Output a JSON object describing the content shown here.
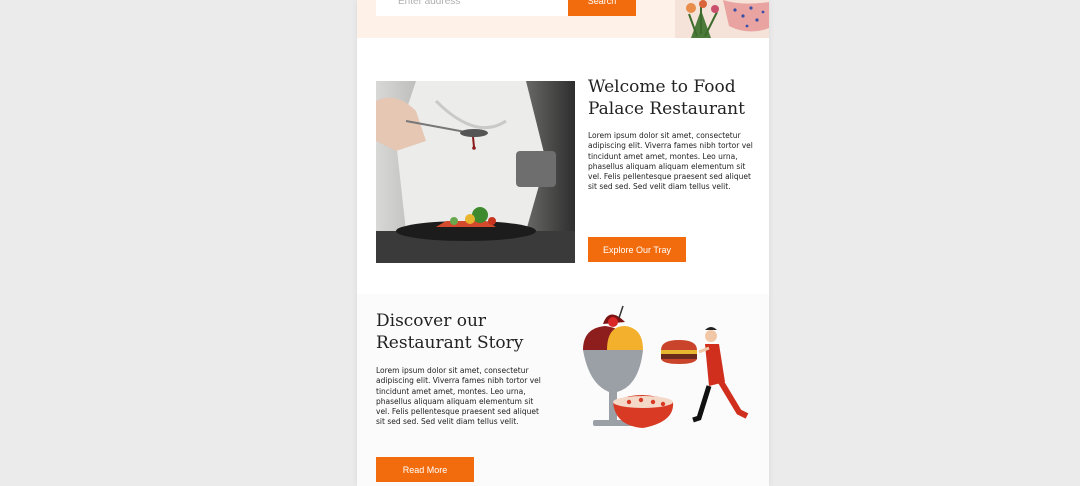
{
  "search": {
    "placeholder": "Enter address",
    "button_label": "Search"
  },
  "welcome": {
    "title": "Welcome to Food Palace Restaurant",
    "body": "Lorem ipsum dolor sit amet, consectetur adipiscing elit. Viverra fames nibh tortor vel tincidunt amet amet, montes. Leo urna, phasellus aliquam aliquam elementum sit vel. Felis pellentesque praesent sed aliquet sit sed sed. Sed velit diam tellus velit.",
    "button_label": "Explore Our Tray"
  },
  "story": {
    "title": "Discover our Restaurant Story",
    "body": "Lorem ipsum dolor sit amet, consectetur adipiscing elit. Viverra fames nibh tortor vel tincidunt amet amet, montes. Leo urna, phasellus aliquam aliquam elementum sit vel. Felis pellentesque praesent sed aliquet sit sed sed. Sed velit diam tellus velit.",
    "button_label": "Read More"
  },
  "colors": {
    "accent": "#f26c0d",
    "page_bg": "#ebebeb",
    "hero_bg": "#fdf1e8",
    "card_bg": "#ffffff"
  },
  "icons": {
    "hero_decoration": "flower-bouquet-illustration",
    "story_art": "dessert-and-chef-illustration"
  }
}
